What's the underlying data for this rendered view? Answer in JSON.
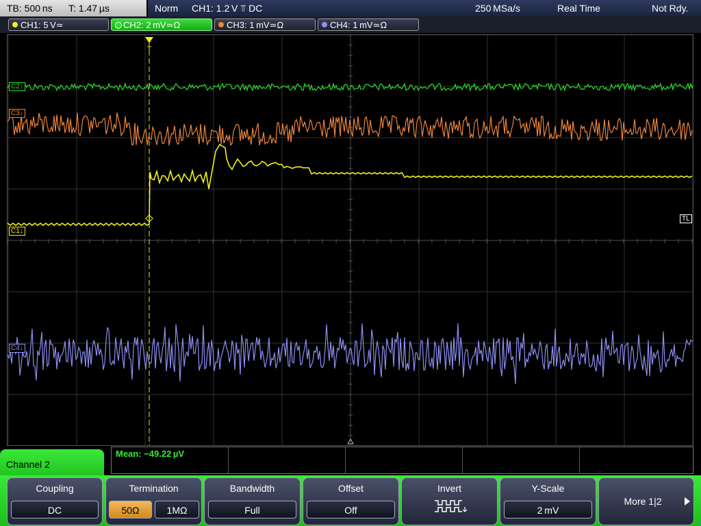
{
  "status_bar": {
    "timebase": "TB: 500 ns",
    "trigger_time": "T: 1.47 µs",
    "trigger_mode": "Norm",
    "trigger_setting": "CH1: 1.2 V ⫪ DC",
    "sample_rate": "250 MSa/s",
    "acquisition_mode": "Real Time",
    "status": "Not Rdy."
  },
  "channels": [
    {
      "label": "CH1: 5 V≃",
      "color": "#f2f21b",
      "active": false
    },
    {
      "label": "CH2: 2 mV≃Ω",
      "color": "#27e027",
      "active": true
    },
    {
      "label": "CH3: 1 mV≃Ω",
      "color": "#f0863a",
      "active": false
    },
    {
      "label": "CH4: 1 mV≃Ω",
      "color": "#8f8ff5",
      "active": false
    }
  ],
  "markers": {
    "c1": "C1↓",
    "c2": "C2↓",
    "c3": "C3↓",
    "c4": "C4↓",
    "trigger_level": "TL",
    "trigger_position": "T"
  },
  "measurement": {
    "text": "Mean: −49.22 µV"
  },
  "menu": {
    "title": "Channel 2",
    "coupling": {
      "label": "Coupling",
      "value": "DC"
    },
    "termination": {
      "label": "Termination",
      "option_50": "50Ω",
      "option_1m": "1MΩ",
      "selected": "50Ω"
    },
    "bandwidth": {
      "label": "Bandwidth",
      "value": "Full"
    },
    "offset": {
      "label": "Offset",
      "value": "Off"
    },
    "invert": {
      "label": "Invert",
      "icon": "inverted-waveform-icon"
    },
    "yscale": {
      "label": "Y-Scale",
      "value": "2 mV"
    },
    "more": {
      "label": "More 1|2",
      "icon": "arrow-right-icon"
    }
  },
  "colors": {
    "ch1": "#f2f21b",
    "ch2": "#27e027",
    "ch3": "#f0863a",
    "ch4": "#8f8ff5",
    "menu_green": "#2fd22f",
    "selected_orange": "#e7a03a"
  }
}
